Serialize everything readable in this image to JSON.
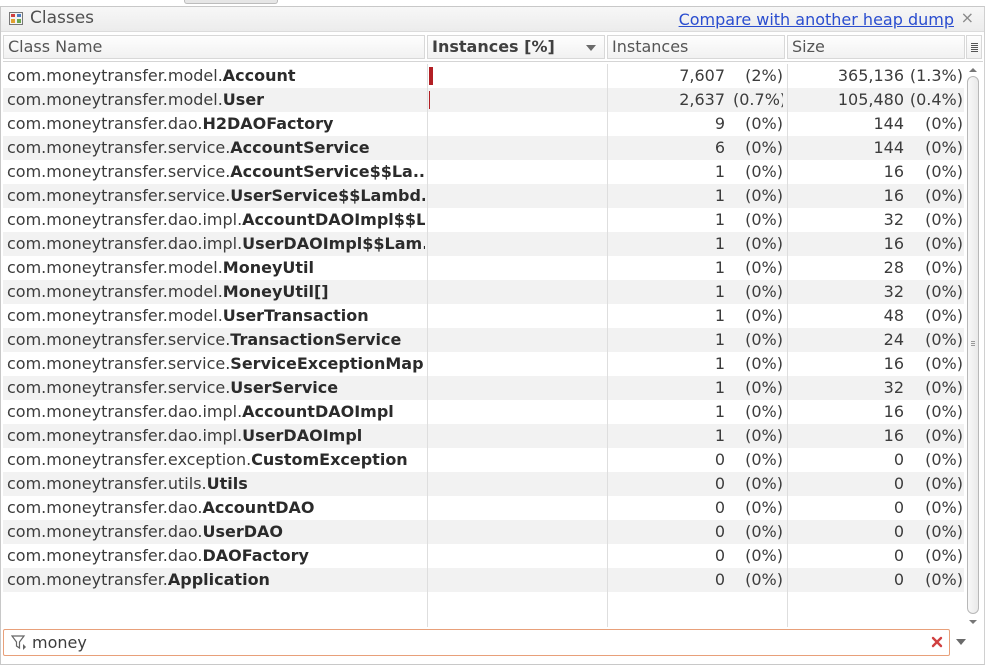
{
  "panel": {
    "title": "Classes",
    "compare_link": "Compare with another heap dump",
    "close_glyph": "×"
  },
  "columns": {
    "class_name": "Class Name",
    "instances_pct": "Instances [%]",
    "instances": "Instances",
    "size": "Size"
  },
  "colors": {
    "bar": "#b21f24",
    "link": "#2a4dcf",
    "filter_border": "#e8a07a"
  },
  "rows": [
    {
      "prefix": "com.moneytransfer.model.",
      "name": "Account",
      "instances": "7,607",
      "inst_pct": "(2%)",
      "size": "365,136",
      "size_pct": "(1.3%)",
      "bar_percent": 2.0
    },
    {
      "prefix": "com.moneytransfer.model.",
      "name": "User",
      "instances": "2,637",
      "inst_pct": "(0.7%)",
      "size": "105,480",
      "size_pct": "(0.4%)",
      "bar_percent": 0.7
    },
    {
      "prefix": "com.moneytransfer.dao.",
      "name": "H2DAOFactory",
      "instances": "9",
      "inst_pct": "(0%)",
      "size": "144",
      "size_pct": "(0%)",
      "bar_percent": 0
    },
    {
      "prefix": "com.moneytransfer.service.",
      "name": "AccountService",
      "instances": "6",
      "inst_pct": "(0%)",
      "size": "144",
      "size_pct": "(0%)",
      "bar_percent": 0
    },
    {
      "prefix": "com.moneytransfer.service.",
      "name": "AccountService$$La...",
      "instances": "1",
      "inst_pct": "(0%)",
      "size": "16",
      "size_pct": "(0%)",
      "bar_percent": 0
    },
    {
      "prefix": "com.moneytransfer.service.",
      "name": "UserService$$Lambd...",
      "instances": "1",
      "inst_pct": "(0%)",
      "size": "16",
      "size_pct": "(0%)",
      "bar_percent": 0
    },
    {
      "prefix": "com.moneytransfer.dao.impl.",
      "name": "AccountDAOImpl$$L...",
      "instances": "1",
      "inst_pct": "(0%)",
      "size": "32",
      "size_pct": "(0%)",
      "bar_percent": 0
    },
    {
      "prefix": "com.moneytransfer.dao.impl.",
      "name": "UserDAOImpl$$Lam...",
      "instances": "1",
      "inst_pct": "(0%)",
      "size": "16",
      "size_pct": "(0%)",
      "bar_percent": 0
    },
    {
      "prefix": "com.moneytransfer.model.",
      "name": "MoneyUtil",
      "instances": "1",
      "inst_pct": "(0%)",
      "size": "28",
      "size_pct": "(0%)",
      "bar_percent": 0
    },
    {
      "prefix": "com.moneytransfer.model.",
      "name": "MoneyUtil[]",
      "instances": "1",
      "inst_pct": "(0%)",
      "size": "32",
      "size_pct": "(0%)",
      "bar_percent": 0
    },
    {
      "prefix": "com.moneytransfer.model.",
      "name": "UserTransaction",
      "instances": "1",
      "inst_pct": "(0%)",
      "size": "48",
      "size_pct": "(0%)",
      "bar_percent": 0
    },
    {
      "prefix": "com.moneytransfer.service.",
      "name": "TransactionService",
      "instances": "1",
      "inst_pct": "(0%)",
      "size": "24",
      "size_pct": "(0%)",
      "bar_percent": 0
    },
    {
      "prefix": "com.moneytransfer.service.",
      "name": "ServiceExceptionMap...",
      "instances": "1",
      "inst_pct": "(0%)",
      "size": "16",
      "size_pct": "(0%)",
      "bar_percent": 0
    },
    {
      "prefix": "com.moneytransfer.service.",
      "name": "UserService",
      "instances": "1",
      "inst_pct": "(0%)",
      "size": "32",
      "size_pct": "(0%)",
      "bar_percent": 0
    },
    {
      "prefix": "com.moneytransfer.dao.impl.",
      "name": "AccountDAOImpl",
      "instances": "1",
      "inst_pct": "(0%)",
      "size": "16",
      "size_pct": "(0%)",
      "bar_percent": 0
    },
    {
      "prefix": "com.moneytransfer.dao.impl.",
      "name": "UserDAOImpl",
      "instances": "1",
      "inst_pct": "(0%)",
      "size": "16",
      "size_pct": "(0%)",
      "bar_percent": 0
    },
    {
      "prefix": "com.moneytransfer.exception.",
      "name": "CustomException",
      "instances": "0",
      "inst_pct": "(0%)",
      "size": "0",
      "size_pct": "(0%)",
      "bar_percent": 0
    },
    {
      "prefix": "com.moneytransfer.utils.",
      "name": "Utils",
      "instances": "0",
      "inst_pct": "(0%)",
      "size": "0",
      "size_pct": "(0%)",
      "bar_percent": 0
    },
    {
      "prefix": "com.moneytransfer.dao.",
      "name": "AccountDAO",
      "instances": "0",
      "inst_pct": "(0%)",
      "size": "0",
      "size_pct": "(0%)",
      "bar_percent": 0
    },
    {
      "prefix": "com.moneytransfer.dao.",
      "name": "UserDAO",
      "instances": "0",
      "inst_pct": "(0%)",
      "size": "0",
      "size_pct": "(0%)",
      "bar_percent": 0
    },
    {
      "prefix": "com.moneytransfer.dao.",
      "name": "DAOFactory",
      "instances": "0",
      "inst_pct": "(0%)",
      "size": "0",
      "size_pct": "(0%)",
      "bar_percent": 0
    },
    {
      "prefix": "com.moneytransfer.",
      "name": "Application",
      "instances": "0",
      "inst_pct": "(0%)",
      "size": "0",
      "size_pct": "(0%)",
      "bar_percent": 0
    }
  ],
  "filter": {
    "value": "money",
    "icon": "filter-icon",
    "clear_icon": "clear-icon"
  }
}
